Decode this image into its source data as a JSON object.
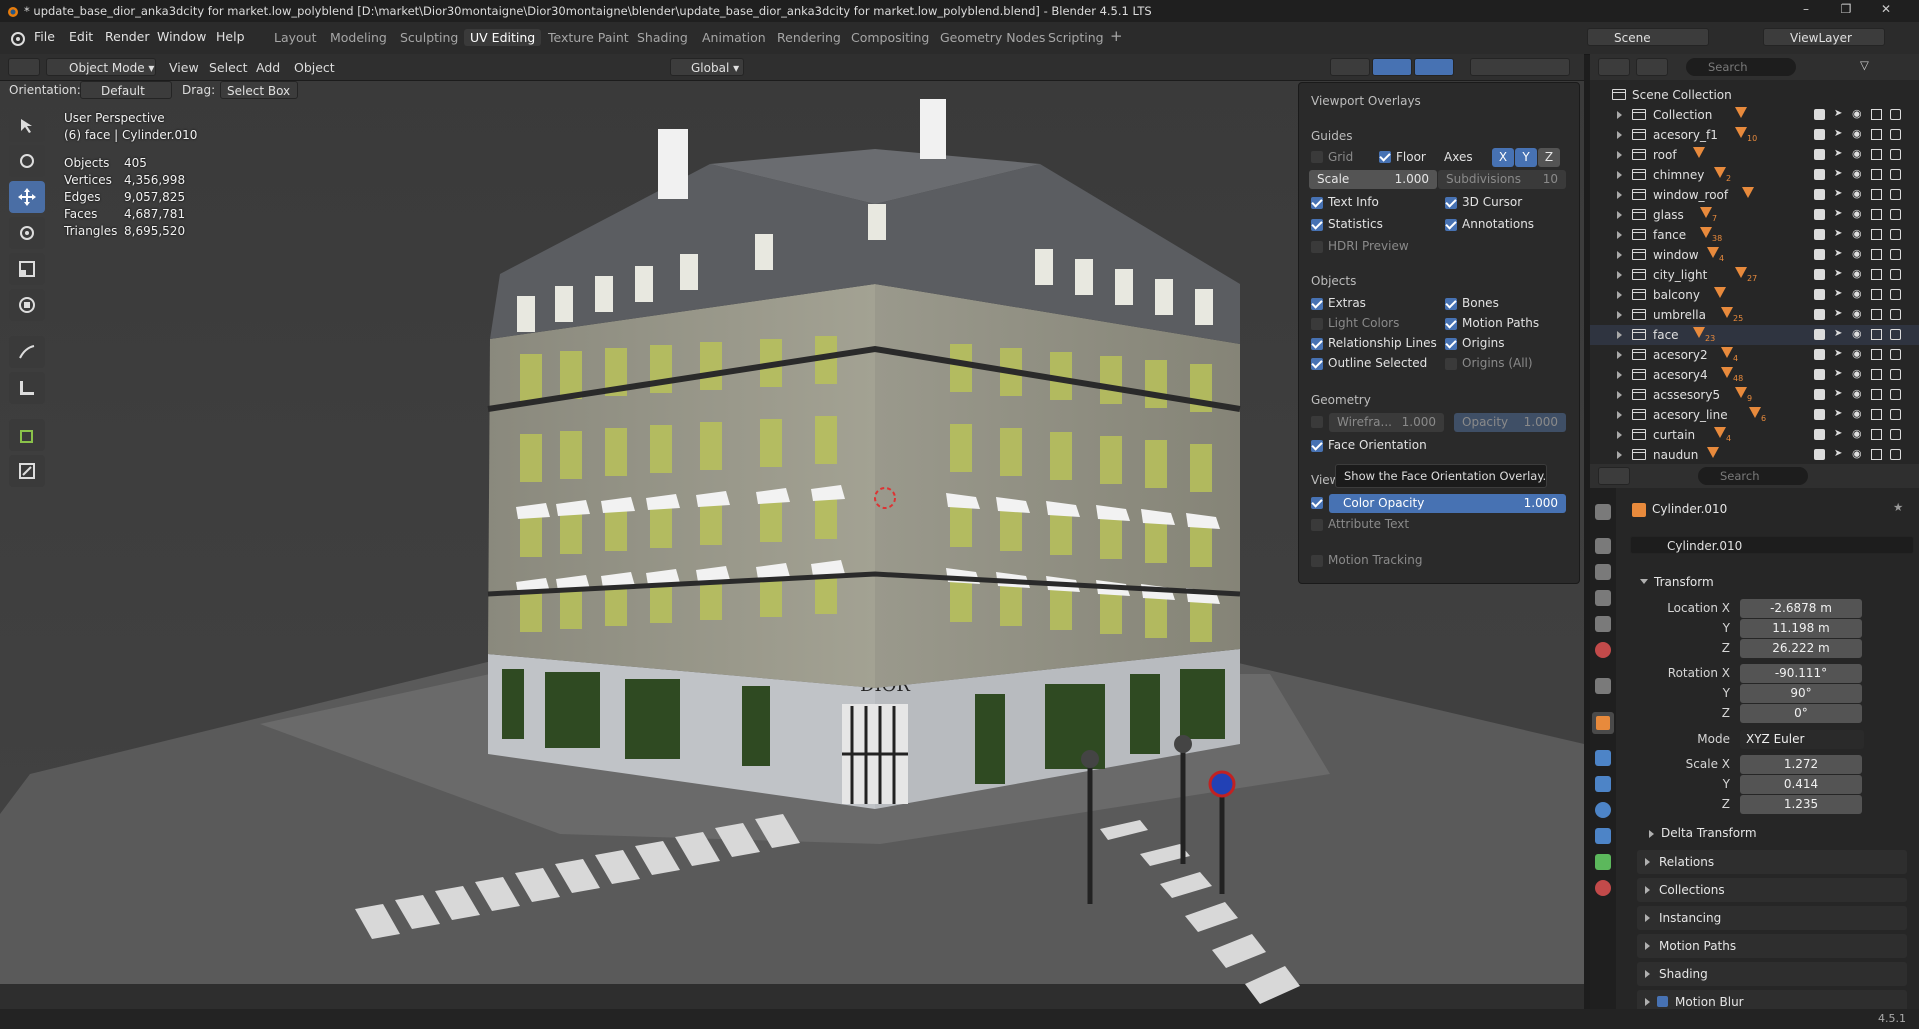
{
  "window": {
    "title": "* update_base_dior_anka3dcity for market.low_polyblend [D:\\market\\Dior30montaigne\\Dior30montaigne\\blender\\update_base_dior_anka3dcity for market.low_polyblend.blend] - Blender 4.5.1 LTS"
  },
  "menu": {
    "file": "File",
    "edit": "Edit",
    "render": "Render",
    "window": "Window",
    "help": "Help"
  },
  "workspaces": [
    "Layout",
    "Modeling",
    "Sculpting",
    "UV Editing",
    "Texture Paint",
    "Shading",
    "Animation",
    "Rendering",
    "Compositing",
    "Geometry Nodes",
    "Scripting"
  ],
  "active_workspace": "UV Editing",
  "topright": {
    "scene": "Scene",
    "viewlayer": "ViewLayer"
  },
  "viewport_header": {
    "mode": "Object Mode",
    "view": "View",
    "select": "Select",
    "add": "Add",
    "object": "Object",
    "transform_orientation": "Global",
    "orientation_label": "Orientation:",
    "orientation_value": "Default",
    "drag_label": "Drag:",
    "drag_value": "Select Box"
  },
  "viewport_info": {
    "perspective": "User Perspective",
    "object": "(6) face | Cylinder.010",
    "stats": [
      {
        "label": "Objects",
        "value": "405"
      },
      {
        "label": "Vertices",
        "value": "4,356,998"
      },
      {
        "label": "Edges",
        "value": "9,057,825"
      },
      {
        "label": "Faces",
        "value": "4,687,781"
      },
      {
        "label": "Triangles",
        "value": "8,695,520"
      }
    ]
  },
  "scene_text": {
    "sign": "DIOR"
  },
  "overlays": {
    "title": "Viewport Overlays",
    "guides": "Guides",
    "grid": "Grid",
    "floor": "Floor",
    "axes": "Axes",
    "x": "X",
    "y": "Y",
    "z": "Z",
    "scale_label": "Scale",
    "scale_value": "1.000",
    "subdiv_label": "Subdivisions",
    "subdiv_value": "10",
    "text_info": "Text Info",
    "cursor": "3D Cursor",
    "statistics": "Statistics",
    "annotations": "Annotations",
    "hdri": "HDRI Preview",
    "objects": "Objects",
    "extras": "Extras",
    "bones": "Bones",
    "light_colors": "Light Colors",
    "motion_paths": "Motion Paths",
    "relationship_lines": "Relationship Lines",
    "origins": "Origins",
    "outline_selected": "Outline Selected",
    "origins_all": "Origins (All)",
    "geometry": "Geometry",
    "wireframe_label": "Wirefra...",
    "wireframe_value": "1.000",
    "opacity_label": "Opacity",
    "opacity_value": "1.000",
    "face_orientation": "Face Orientation",
    "viewer": "View",
    "tooltip": "Show the Face Orientation Overlay.",
    "color_opacity_label": "Color Opacity",
    "color_opacity_value": "1.000",
    "attribute_text": "Attribute Text",
    "motion_tracking": "Motion Tracking"
  },
  "outliner": {
    "search_placeholder": "Search",
    "root": "Scene Collection",
    "items": [
      {
        "name": "Collection",
        "count": ""
      },
      {
        "name": "acesory_f1",
        "count": "10"
      },
      {
        "name": "roof",
        "count": ""
      },
      {
        "name": "chimney",
        "count": "2"
      },
      {
        "name": "window_roof",
        "count": ""
      },
      {
        "name": "glass",
        "count": "7"
      },
      {
        "name": "fance",
        "count": "38"
      },
      {
        "name": "window",
        "count": "4"
      },
      {
        "name": "city_light",
        "count": "27"
      },
      {
        "name": "balcony",
        "count": ""
      },
      {
        "name": "umbrella",
        "count": "25"
      },
      {
        "name": "face",
        "count": "23"
      },
      {
        "name": "acesory2",
        "count": "4"
      },
      {
        "name": "acesory4",
        "count": "48"
      },
      {
        "name": "acssesory5",
        "count": "9"
      },
      {
        "name": "acesory_line",
        "count": "6"
      },
      {
        "name": "curtain",
        "count": "4"
      },
      {
        "name": "naudun",
        "count": ""
      }
    ]
  },
  "properties": {
    "search_placeholder": "Search",
    "object_name": "Cylinder.010",
    "object_field": "Cylinder.010",
    "transform": "Transform",
    "location_label": "Location X",
    "loc_x": "-2.6878 m",
    "y_label": "Y",
    "loc_y": "11.198 m",
    "z_label": "Z",
    "loc_z": "26.222 m",
    "rotation_label": "Rotation X",
    "rot_x": "-90.111°",
    "rot_y": "90°",
    "rot_z": "0°",
    "mode_label": "Mode",
    "mode_value": "XYZ Euler",
    "scale_label": "Scale X",
    "scale_x": "1.272",
    "scale_y": "0.414",
    "scale_z": "1.235",
    "delta": "Delta Transform",
    "sections": [
      "Relations",
      "Collections",
      "Instancing",
      "Motion Paths",
      "Shading",
      "Motion Blur"
    ]
  },
  "status": {
    "version": "4.5.1"
  }
}
